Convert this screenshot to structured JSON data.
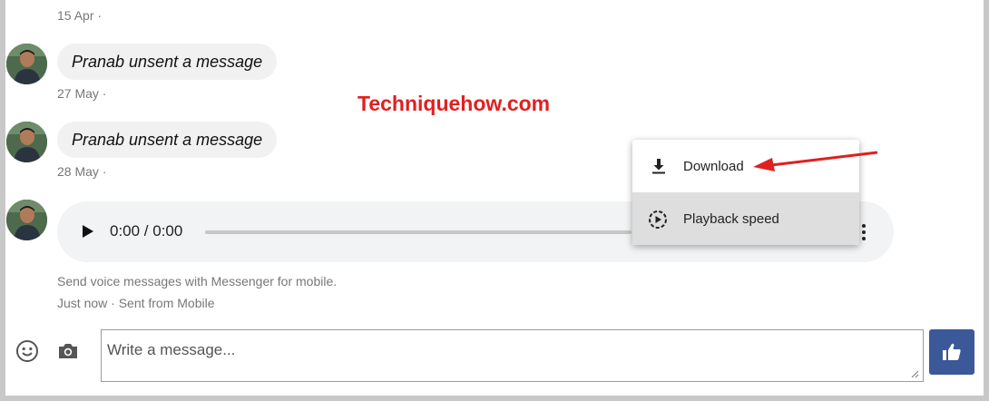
{
  "messages": [
    {
      "date": "15 Apr ·"
    },
    {
      "text": "Pranab unsent a message",
      "date": "27 May ·"
    },
    {
      "text": "Pranab unsent a message",
      "date": "28 May ·"
    }
  ],
  "watermark": "Techniquehow.com",
  "audio": {
    "time": "0:00 / 0:00"
  },
  "menu": {
    "items": [
      {
        "label": "Download",
        "icon": "download-icon"
      },
      {
        "label": "Playback speed",
        "icon": "playback-speed-icon"
      }
    ]
  },
  "voice_note": "Send voice messages with Messenger for mobile.",
  "voice_status": "Just now · Sent from Mobile",
  "composer": {
    "placeholder": "Write a message..."
  },
  "colors": {
    "accent": "#3b5998",
    "arrow": "#e0201f",
    "watermark": "#e0201f"
  }
}
